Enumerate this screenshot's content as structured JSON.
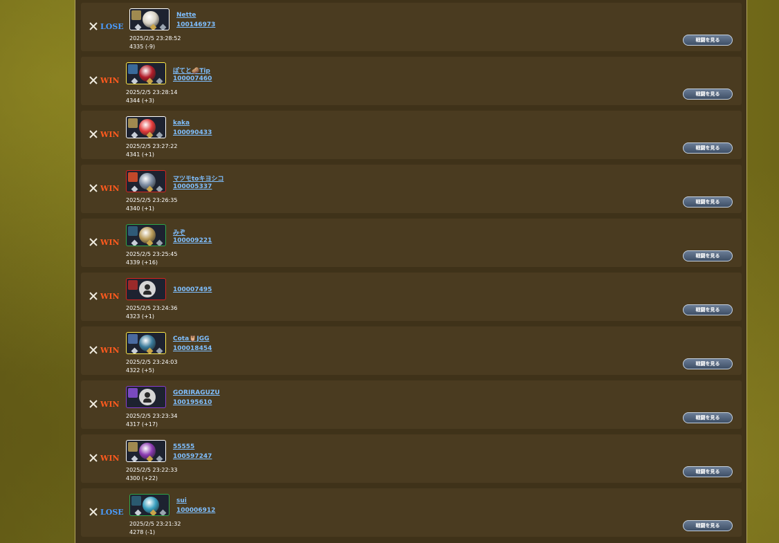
{
  "battle_button_label": "戦闘を見る",
  "colors": {
    "win": "#ff5a1e",
    "lose": "#4a9cff",
    "link": "#7fbfff",
    "row_bg": "#4a3b20"
  },
  "battles": [
    {
      "result": "LOSE",
      "name": "Nette",
      "player_id": "100146973",
      "datetime": "2025/2/5 23:28:52",
      "rating": "4335 (-9)",
      "frame": "#ffffff",
      "face": "#d8d2c4",
      "leader": "#a08a50"
    },
    {
      "result": "WIN",
      "name": "ぽてと🥔Tip",
      "player_id": "100007460",
      "datetime": "2025/2/5 23:28:14",
      "rating": "4344 (+3)",
      "frame": "#ffe94a",
      "face": "#b21d2a",
      "leader": "#3a6a9a"
    },
    {
      "result": "WIN",
      "name": "kaka",
      "player_id": "100090433",
      "datetime": "2025/2/5 23:27:22",
      "rating": "4341 (+1)",
      "frame": "#ffffff",
      "face": "#e23a3a",
      "leader": "#a08a50"
    },
    {
      "result": "WIN",
      "name": "マツモtoキヨシコ",
      "player_id": "100005337",
      "datetime": "2025/2/5 23:26:35",
      "rating": "4340 (+1)",
      "frame": "#d8231f",
      "face": "#7b8aa0",
      "leader": "#c2482a"
    },
    {
      "result": "WIN",
      "name": "みぞ",
      "player_id": "100009221",
      "datetime": "2025/2/5 23:25:45",
      "rating": "4339 (+16)",
      "frame": "#2fa84a",
      "face": "#b89a58",
      "leader": "#2f5a78"
    },
    {
      "result": "WIN",
      "name": "",
      "player_id": "100007495",
      "datetime": "2025/2/5 23:24:36",
      "rating": "4323 (+1)",
      "frame": "#d8231f",
      "face": "",
      "leader": "#9a2a2a",
      "default_avatar": true
    },
    {
      "result": "WIN",
      "name": "Cota🦉JGG",
      "player_id": "100018454",
      "datetime": "2025/2/5 23:24:03",
      "rating": "4322 (+5)",
      "frame": "#ffe94a",
      "face": "#3a7a9a",
      "leader": "#4a6aa0"
    },
    {
      "result": "WIN",
      "name": "GORIRAGUZU",
      "player_id": "100195610",
      "datetime": "2025/2/5 23:23:34",
      "rating": "4317 (+17)",
      "frame": "#8a3fd0",
      "face": "",
      "leader": "#7a4ac0",
      "default_avatar": true
    },
    {
      "result": "WIN",
      "name": "55555",
      "player_id": "100597247",
      "datetime": "2025/2/5 23:22:33",
      "rating": "4300 (+22)",
      "frame": "#ffffff",
      "face": "#8a3ab0",
      "leader": "#a08a50"
    },
    {
      "result": "LOSE",
      "name": "sui",
      "player_id": "100006912",
      "datetime": "2025/2/5 23:21:32",
      "rating": "4278 (-1)",
      "frame": "#2fa84a",
      "face": "#3aa0c0",
      "leader": "#2a5a70"
    }
  ]
}
